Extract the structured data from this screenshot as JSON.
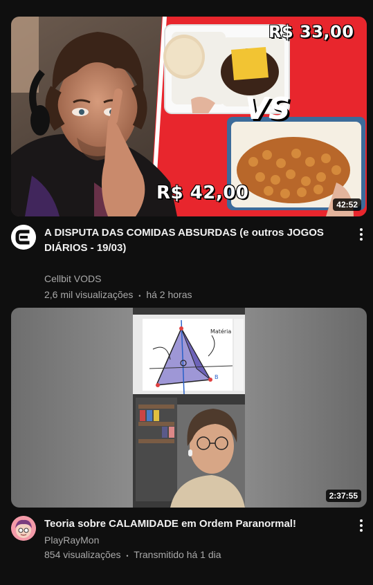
{
  "videos": [
    {
      "title": "A DISPUTA DAS COMIDAS ABSURDAS (e outros JOGOS DIÁRIOS - 19/03)",
      "channel": "Cellbit VODS",
      "views": "2,6 mil visualizações",
      "separator": "•",
      "age": "há 2 horas",
      "duration": "42:52",
      "thumb_text": {
        "price_top": "R$ 33,00",
        "vs": "VS",
        "price_bottom": "R$ 42,00"
      },
      "avatar_letter": "C",
      "accent": "#e8262d"
    },
    {
      "title": "Teoria sobre CALAMIDADE em Ordem Paranormal!",
      "channel": "PlayRayMon",
      "views": "854 visualizações",
      "separator": "•",
      "age": "Transmitido há 1 dia",
      "duration": "2:37:55",
      "thumb_text": {
        "diagram_label": "Matéria",
        "diagram_vertex_b": "B"
      }
    }
  ],
  "icons": {
    "more": "vertical-dots-icon"
  }
}
